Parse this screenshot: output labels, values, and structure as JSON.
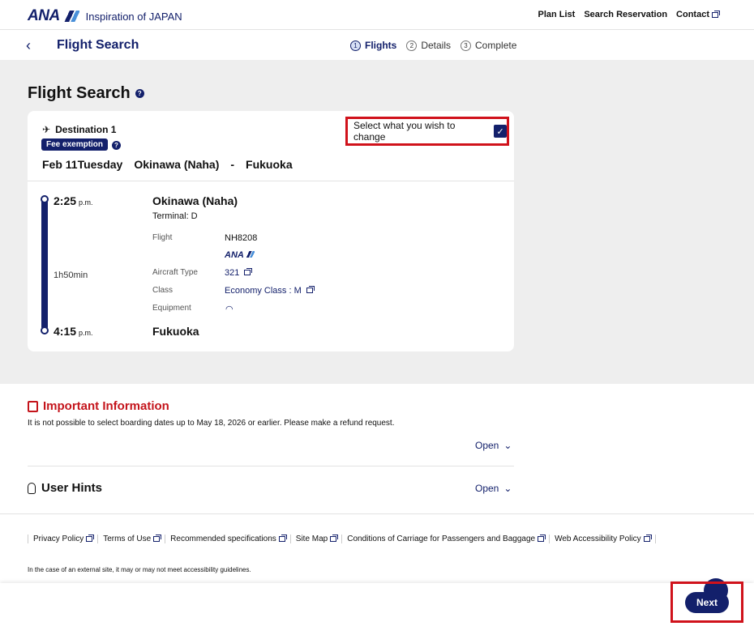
{
  "header": {
    "logo_text": "ANA",
    "tagline": "Inspiration of JAPAN",
    "nav": [
      "Plan List",
      "Search Reservation",
      "Contact"
    ]
  },
  "subheader": {
    "title": "Flight Search",
    "steps": [
      {
        "num": "1",
        "label": "Flights"
      },
      {
        "num": "2",
        "label": "Details"
      },
      {
        "num": "3",
        "label": "Complete"
      }
    ]
  },
  "main": {
    "page_title": "Flight Search",
    "card": {
      "destination": "Destination 1",
      "badge": "Fee exemption",
      "change_label": "Select what you wish to change",
      "date": "Feb 11Tuesday",
      "origin": "Okinawa (Naha)",
      "dash": "-",
      "destination_city": "Fukuoka",
      "depart_time": "2:25",
      "arrive_time": "4:15",
      "ampm": "p.m.",
      "duration": "1h50min",
      "depart_airport": "Okinawa (Naha)",
      "terminal": "Terminal: D",
      "arrive_airport": "Fukuoka",
      "flight_label": "Flight",
      "flight_value": "NH8208",
      "airline_logo": "ANA",
      "aircraft_label": "Aircraft Type",
      "aircraft_value": "321",
      "class_label": "Class",
      "class_value": "Economy Class : M",
      "equipment_label": "Equipment"
    }
  },
  "info": {
    "important_title": "Important Information",
    "important_text": "It is not possible to select boarding dates up to May 18, 2026 or earlier. Please make a refund request.",
    "open_label": "Open",
    "hints_title": "User Hints"
  },
  "footer": {
    "links": [
      "Privacy Policy",
      "Terms of Use",
      "Recommended specifications",
      "Site Map",
      "Conditions of Carriage for Passengers and Baggage",
      "Web Accessibility Policy"
    ],
    "note": "In the case of an external site, it may or may not meet accessibility guidelines."
  },
  "actions": {
    "next": "Next"
  },
  "colors": {
    "brand": "#13206b",
    "alert": "#c4141b",
    "highlight": "#d0121b",
    "background": "#eeeeee"
  }
}
